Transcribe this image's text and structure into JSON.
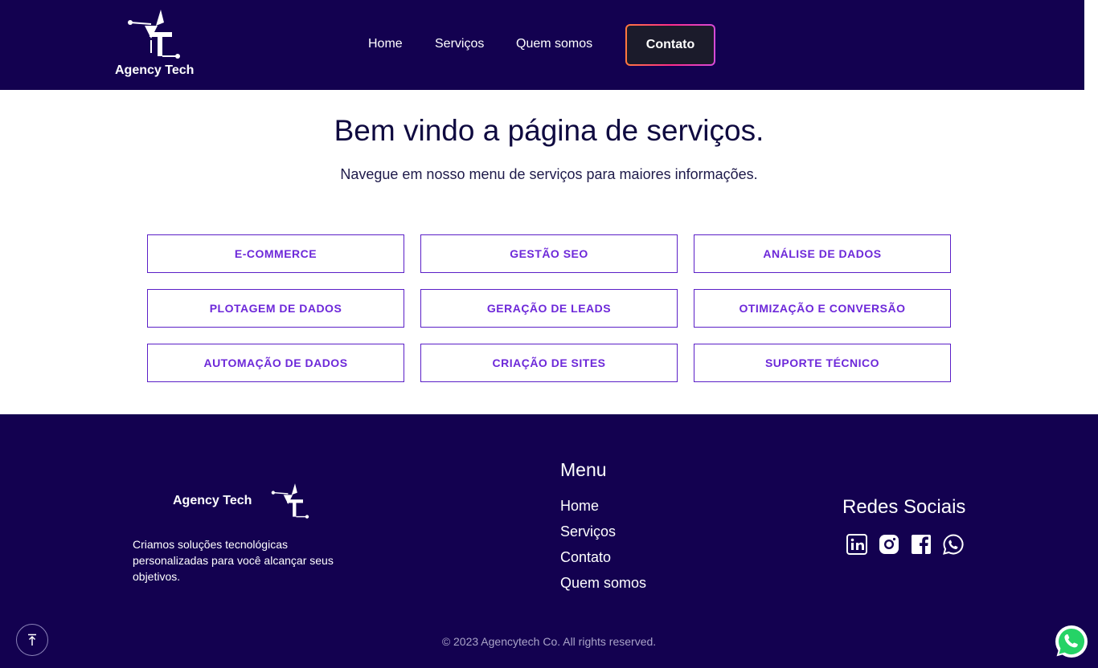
{
  "header": {
    "brand": "Agency Tech",
    "nav": [
      "Home",
      "Serviços",
      "Quem somos"
    ],
    "cta": "Contato"
  },
  "hero": {
    "title": "Bem vindo a página de serviços.",
    "subtitle": "Navegue em nosso menu de serviços para maiores informações."
  },
  "services": [
    "E-COMMERCE",
    "GESTÃO SEO",
    "ANÁLISE DE DADOS",
    "PLOTAGEM DE DADOS",
    "GERAÇÃO DE LEADS",
    "OTIMIZAÇÃO E CONVERSÃO",
    "AUTOMAÇÃO DE DADOS",
    "CRIAÇÃO DE SITES",
    "SUPORTE TÉCNICO"
  ],
  "footer": {
    "brand": "Agency Tech",
    "description": "Criamos soluções tecnológicas personalizadas para você alcançar seus objetivos.",
    "menu_title": "Menu",
    "menu_items": [
      "Home",
      "Serviços",
      "Contato",
      "Quem somos"
    ],
    "social_title": "Redes Sociais",
    "social_icons": [
      "linkedin-icon",
      "instagram-icon",
      "facebook-icon",
      "whatsapp-icon"
    ],
    "copyright": "© 2023 Agencytech Co. All rights reserved."
  },
  "colors": {
    "primary": "#130150",
    "accent": "#6d28d9",
    "cta_gradient": [
      "#ff7a3d",
      "#ff2d8a",
      "#d64bd8"
    ]
  }
}
